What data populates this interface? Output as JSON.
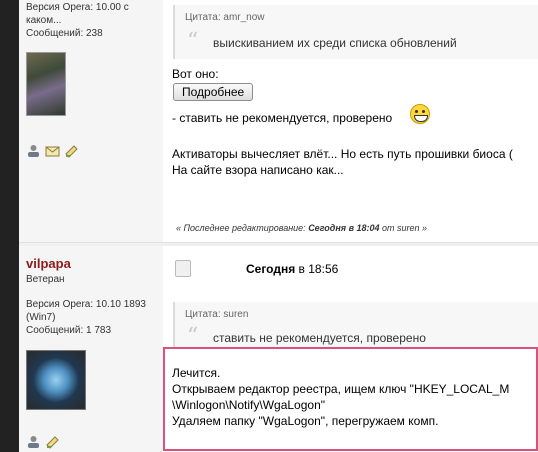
{
  "post1": {
    "profile": {
      "opera_version": "Версия Opera: 10.00 с",
      "opera_version_cont": "каком...",
      "messages": "Сообщений: 238"
    },
    "quote": {
      "header": "Цитата: amr_now",
      "text": "выискиванием их среди списка обновлений"
    },
    "line_here": "Вот оно:",
    "details_button": "Подробнее",
    "line_not_recommended": "- ставить не рекомендуется, проверено",
    "activators_line": "Активаторы вычесляет влёт... Но есть путь прошивки биоса (",
    "site_line": "На сайте взора написано как...",
    "edit_note": {
      "prefix": "« Последнее редактирование: ",
      "when": "Сегодня в 18:04",
      "by": " от suren »"
    }
  },
  "post2": {
    "profile": {
      "username": "vilpapa",
      "rank": "Ветеран",
      "opera_version": "Версия Opera: 10.10 1893",
      "os": "(Win7)",
      "messages": "Сообщений: 1 783"
    },
    "date_bold": "Сегодня",
    "date_rest": " в 18:56",
    "quote": {
      "header": "Цитата: suren",
      "text": "ставить не рекомендуется, проверено"
    },
    "lines": [
      "Лечится.",
      "Открываем редактор реестра, ищем ключ \"HKEY_LOCAL_M",
      "\\Winlogon\\Notify\\WgaLogon\"",
      "Удаляем папку \"WgaLogon\", перегружаем комп."
    ]
  }
}
